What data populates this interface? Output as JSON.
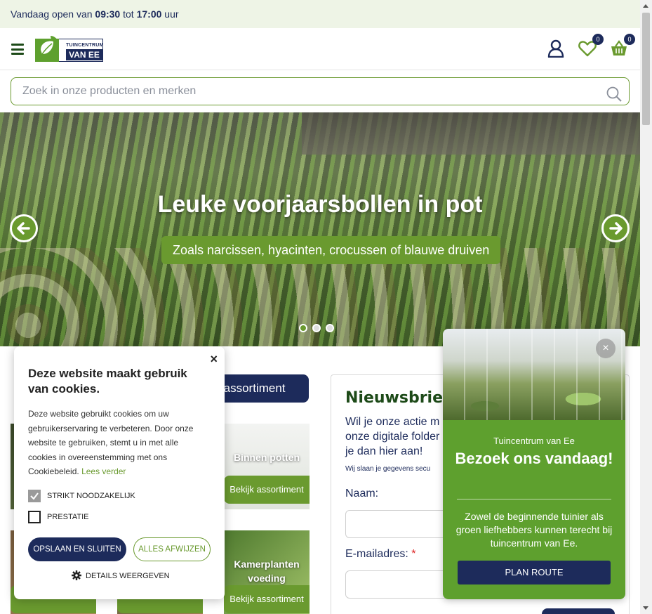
{
  "topbar": {
    "prefix": "Vandaag open van",
    "open": "09:30",
    "mid": "tot",
    "close": "17:00",
    "suffix": "uur"
  },
  "header": {
    "logo_line1": "TUINCENTRUM",
    "logo_line2": "VAN EE",
    "wishlist_count": "0",
    "cart_count": "0"
  },
  "search": {
    "placeholder": "Zoek in onze producten en merken"
  },
  "hero": {
    "title": "Leuke voorjaarsbollen in pot",
    "subtitle": "Zoals narcissen, hyacinten, crocussen of blauwe druiven"
  },
  "assortment": {
    "button_label": "ge assortiment",
    "tiles": [
      {
        "title": "Binnen potten",
        "button": "Bekijk assortiment"
      },
      {
        "title": "Kamerplanten voeding",
        "button": "Bekijk assortiment"
      }
    ]
  },
  "newsletter": {
    "title": "Nieuwsbrief",
    "intro": "Wil je onze actie m onze digitale folder je dan hier aan!",
    "privacy": "Wij slaan je gegevens secu",
    "name_label": "Naam:",
    "email_label": "E-mailadres:",
    "required": "*"
  },
  "cookie": {
    "close": "×",
    "title": "Deze website maakt gebruik van cookies.",
    "text": "Deze website gebruikt cookies om uw gebruikerservaring te verbeteren. Door onze website te gebruiken, stemt u in met alle cookies in overeenstemming met ons Cookiebeleid.",
    "more": "Lees verder",
    "option_necessary": "STRIKT NOODZAKELIJK",
    "option_performance": "PRESTATIE",
    "save_button": "OPSLAAN EN SLUITEN",
    "reject_button": "ALLES AFWIJZEN",
    "details": "DETAILS WEERGEVEN"
  },
  "visit_popup": {
    "close": "×",
    "small": "Tuincentrum van Ee",
    "title": "Bezoek ons vandaag!",
    "text": "Zowel de beginnende tuinier als groen liefhebbers kunnen terecht bij tuincentrum van Ee.",
    "button": "PLAN ROUTE"
  },
  "colors": {
    "green": "#6a9a2f",
    "navy": "#1d2b5b",
    "topbar_bg": "#eef4e6",
    "popup_green": "#5ea02e"
  }
}
